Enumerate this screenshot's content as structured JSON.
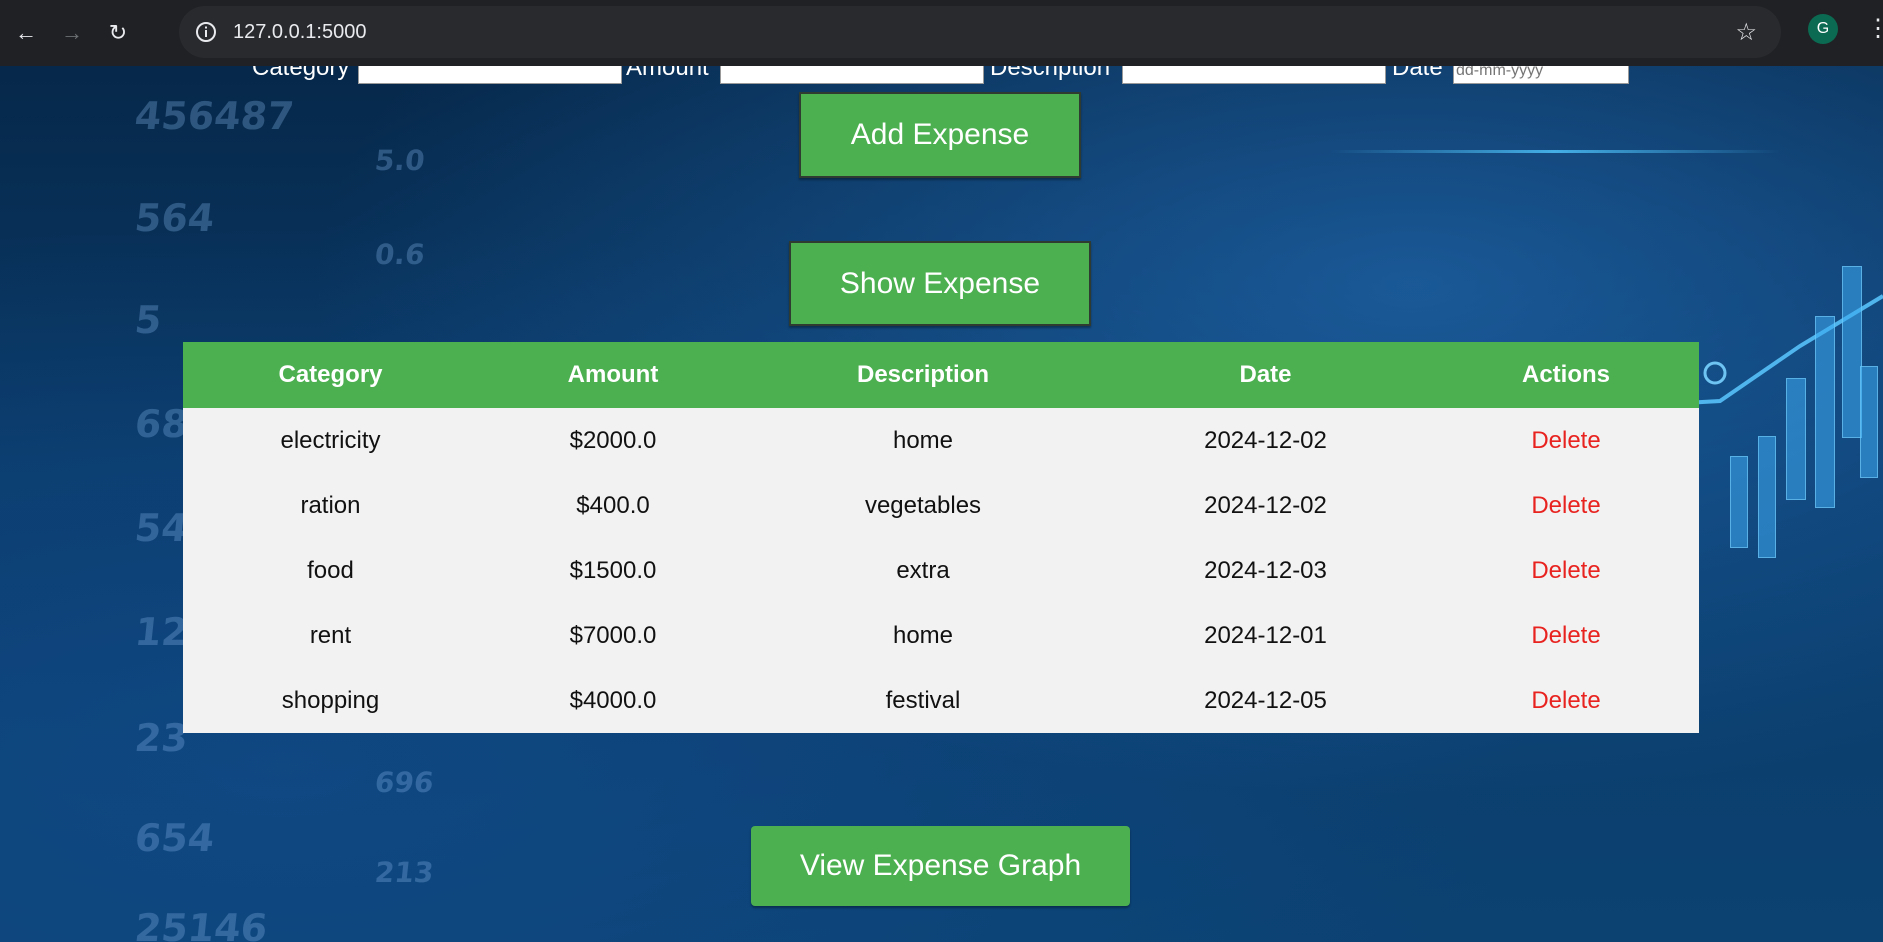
{
  "browser": {
    "url": "127.0.0.1:5000",
    "profile_initial": "G"
  },
  "form": {
    "category_label": "Category",
    "amount_label": "Amount",
    "description_label": "Description",
    "date_label": "Date",
    "date_placeholder": "dd-mm-yyyy"
  },
  "buttons": {
    "add_expense": "Add Expense",
    "show_expense": "Show Expense",
    "view_graph": "View Expense Graph"
  },
  "table": {
    "headers": [
      "Category",
      "Amount",
      "Description",
      "Date",
      "Actions"
    ],
    "rows": [
      {
        "category": "electricity",
        "amount": "$2000.0",
        "description": "home",
        "date": "2024-12-02",
        "action": "Delete"
      },
      {
        "category": "ration",
        "amount": "$400.0",
        "description": "vegetables",
        "date": "2024-12-02",
        "action": "Delete"
      },
      {
        "category": "food",
        "amount": "$1500.0",
        "description": "extra",
        "date": "2024-12-03",
        "action": "Delete"
      },
      {
        "category": "rent",
        "amount": "$7000.0",
        "description": "home",
        "date": "2024-12-01",
        "action": "Delete"
      },
      {
        "category": "shopping",
        "amount": "$4000.0",
        "description": "festival",
        "date": "2024-12-05",
        "action": "Delete"
      }
    ]
  },
  "background_numbers": [
    "456487",
    "564",
    "5",
    "68",
    "54",
    "12",
    "23",
    "654",
    "25146",
    "5.0",
    "0.6",
    "696",
    "213"
  ],
  "colors": {
    "accent": "#4caf50",
    "delete": "#e8231f",
    "table_bg": "#f2f2f2"
  }
}
